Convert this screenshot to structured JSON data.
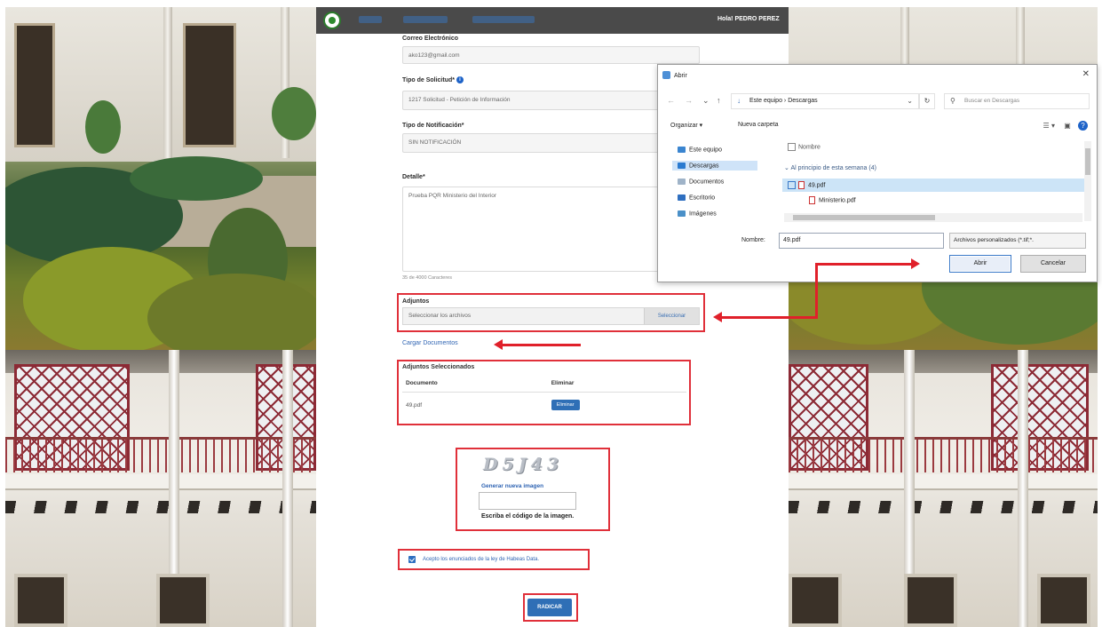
{
  "navbar": {
    "user": "Hola! PEDRO PEREZ"
  },
  "form": {
    "email_label": "Correo Electrónico",
    "email_value": "ako123@gmail.com",
    "request_type_label": "Tipo de Solicitud*",
    "request_type_value": "1217 Solicitud - Petición de Información",
    "notification_type_label": "Tipo de Notificación*",
    "notification_type_value": "SIN NOTIFICACIÓN",
    "detail_label": "Detalle*",
    "detail_value": "Prueba PQR Ministerio del Interior",
    "char_counter": "35 de 4000 Caracteres",
    "attachments_label": "Adjuntos",
    "attachments_placeholder": "Seleccionar los archivos",
    "select_button": "Seleccionar",
    "upload_link": "Cargar Documentos",
    "selected_title": "Adjuntos Seleccionados",
    "table_headers": [
      "Documento",
      "Eliminar"
    ],
    "table_rows": [
      {
        "document": "49.pdf",
        "delete_label": "Eliminar"
      }
    ],
    "captcha_text": "D5J43",
    "captcha_regen": "Generar nueva imagen",
    "captcha_hint": "Escriba el código de la imagen.",
    "terms_label": "Acepto los enunciados de la ley de Habeas Data.",
    "submit_label": "RADICAR"
  },
  "dialog": {
    "title": "Abrir",
    "breadcrumb": "Este equipo › Descargas",
    "search_placeholder": "Buscar en Descargas",
    "organize": "Organizar ▾",
    "new_folder": "Nueva carpeta",
    "nav_items": [
      "Este equipo",
      "Descargas",
      "Documentos",
      "Escritorio",
      "Imágenes"
    ],
    "column_name": "Nombre",
    "group_label": "Al principio de esta semana (4)",
    "files": [
      "49.pdf",
      "Ministerio.pdf"
    ],
    "filename_label": "Nombre:",
    "filename_value": "49.pdf",
    "filter_value": "Archivos personalizados (*.tif;*.",
    "open_button": "Abrir",
    "cancel_button": "Cancelar"
  },
  "colors": {
    "annotation_red": "#e0303a",
    "primary_blue": "#2f6fb6"
  }
}
